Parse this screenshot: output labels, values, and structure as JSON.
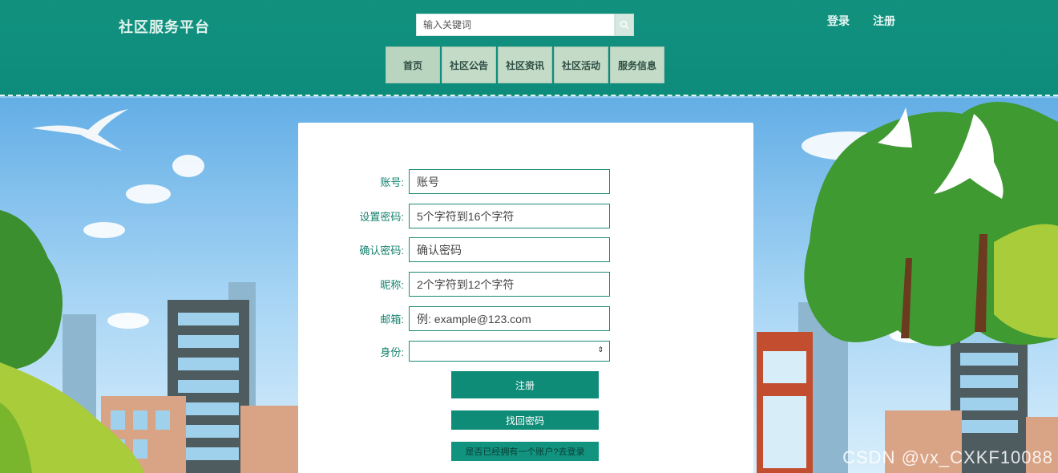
{
  "header": {
    "logo": "社区服务平台",
    "search_placeholder": "输入关键词",
    "login": "登录",
    "register": "注册"
  },
  "nav": {
    "items": [
      "首页",
      "社区公告",
      "社区资讯",
      "社区活动",
      "服务信息"
    ]
  },
  "form": {
    "account_label": "账号:",
    "account_placeholder": "账号",
    "password_label": "设置密码:",
    "password_placeholder": "5个字符到16个字符",
    "confirm_label": "确认密码:",
    "confirm_placeholder": "确认密码",
    "nickname_label": "昵称:",
    "nickname_placeholder": "2个字符到12个字符",
    "email_label": "邮箱:",
    "email_placeholder": "例: example@123.com",
    "role_label": "身份:",
    "role_value": "",
    "register_button": "注册",
    "recover_button": "找回密码",
    "login_link": "是否已经拥有一个账户?去登录"
  },
  "watermark": "CSDN @vx_CXKF10088",
  "colors": {
    "header": "#0d8c7c",
    "accent": "#0f8c78",
    "nav": "#c4dcc7"
  }
}
